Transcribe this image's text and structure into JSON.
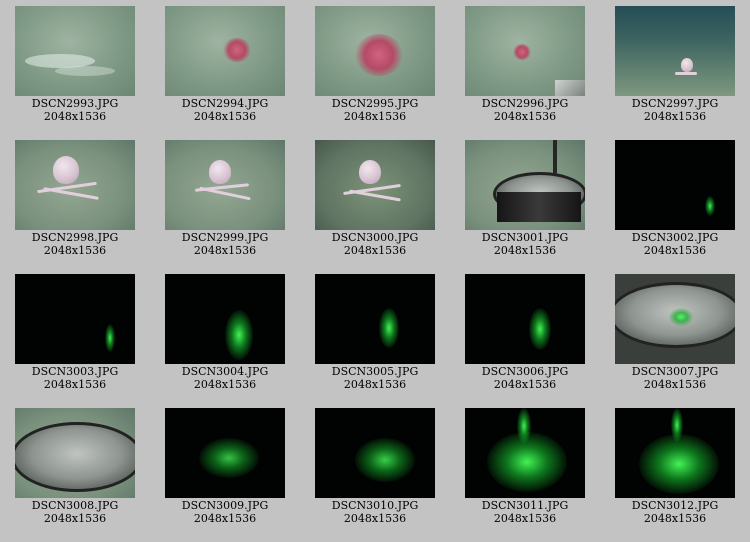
{
  "gallery": {
    "items": [
      {
        "name": "DSCN2993.JPG",
        "size": "2048x1536"
      },
      {
        "name": "DSCN2994.JPG",
        "size": "2048x1536"
      },
      {
        "name": "DSCN2995.JPG",
        "size": "2048x1536"
      },
      {
        "name": "DSCN2996.JPG",
        "size": "2048x1536"
      },
      {
        "name": "DSCN2997.JPG",
        "size": "2048x1536"
      },
      {
        "name": "DSCN2998.JPG",
        "size": "2048x1536"
      },
      {
        "name": "DSCN2999.JPG",
        "size": "2048x1536"
      },
      {
        "name": "DSCN3000.JPG",
        "size": "2048x1536"
      },
      {
        "name": "DSCN3001.JPG",
        "size": "2048x1536"
      },
      {
        "name": "DSCN3002.JPG",
        "size": "2048x1536"
      },
      {
        "name": "DSCN3003.JPG",
        "size": "2048x1536"
      },
      {
        "name": "DSCN3004.JPG",
        "size": "2048x1536"
      },
      {
        "name": "DSCN3005.JPG",
        "size": "2048x1536"
      },
      {
        "name": "DSCN3006.JPG",
        "size": "2048x1536"
      },
      {
        "name": "DSCN3007.JPG",
        "size": "2048x1536"
      },
      {
        "name": "DSCN3008.JPG",
        "size": "2048x1536"
      },
      {
        "name": "DSCN3009.JPG",
        "size": "2048x1536"
      },
      {
        "name": "DSCN3010.JPG",
        "size": "2048x1536"
      },
      {
        "name": "DSCN3011.JPG",
        "size": "2048x1536"
      },
      {
        "name": "DSCN3012.JPG",
        "size": "2048x1536"
      }
    ]
  }
}
